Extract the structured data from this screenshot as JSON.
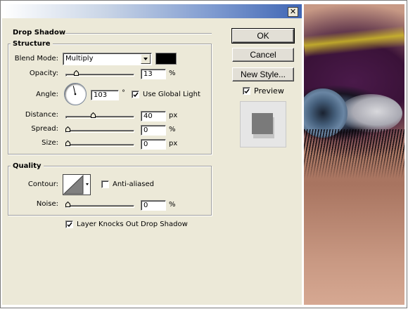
{
  "window": {
    "close_glyph": "✕"
  },
  "drop_shadow": {
    "title": "Drop Shadow",
    "structure": {
      "title": "Structure",
      "blend_mode": {
        "label": "Blend Mode:",
        "value": "Multiply",
        "color": "#000000"
      },
      "opacity": {
        "label": "Opacity:",
        "value": "13",
        "unit": "%",
        "slider_fraction": 0.13
      },
      "angle": {
        "label": "Angle:",
        "value": "103",
        "unit": "°",
        "degrees": 103
      },
      "use_global_light": {
        "label": "Use Global Light",
        "checked": true
      },
      "distance": {
        "label": "Distance:",
        "value": "40",
        "unit": "px",
        "slider_fraction": 0.4
      },
      "spread": {
        "label": "Spread:",
        "value": "0",
        "unit": "%",
        "slider_fraction": 0
      },
      "size": {
        "label": "Size:",
        "value": "0",
        "unit": "px",
        "slider_fraction": 0
      }
    },
    "quality": {
      "title": "Quality",
      "contour": {
        "label": "Contour:"
      },
      "anti_aliased": {
        "label": "Anti-aliased",
        "checked": false
      },
      "noise": {
        "label": "Noise:",
        "value": "0",
        "unit": "%",
        "slider_fraction": 0
      }
    },
    "layer_knocks_out": {
      "label": "Layer Knocks Out Drop Shadow",
      "checked": true
    }
  },
  "buttons": {
    "ok": "OK",
    "cancel": "Cancel",
    "new_style": "New Style..."
  },
  "preview": {
    "label": "Preview",
    "checked": true
  }
}
